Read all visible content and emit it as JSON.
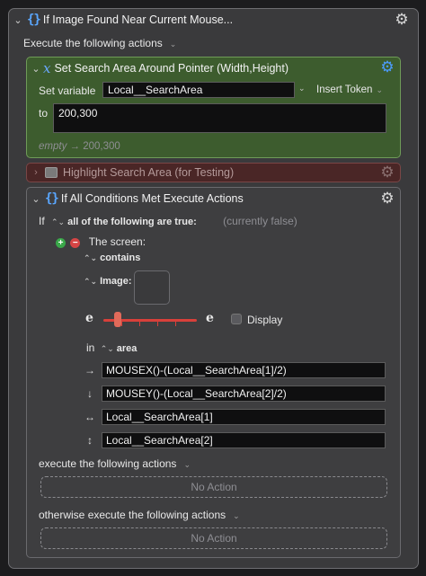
{
  "outer": {
    "title": "If Image Found Near Current Mouse...",
    "execute_label": "Execute the following actions"
  },
  "set_var": {
    "title": "Set Search Area Around Pointer (Width,Height)",
    "set_variable_label": "Set variable",
    "variable_name": "Local__SearchArea",
    "insert_token_label": "Insert Token",
    "to_label": "to",
    "value": "200,300",
    "preview_empty": "empty",
    "preview_value": "200,300"
  },
  "highlight": {
    "title": "Highlight Search Area (for Testing)"
  },
  "inner_if": {
    "title": "If All Conditions Met Execute Actions",
    "if_label": "If",
    "scope": "all of the following are true:",
    "status": "(currently false)",
    "condition_label": "The screen:",
    "contains_label": "contains",
    "image_label": "Image:",
    "display_label": "Display",
    "fuzz_value": 0.13,
    "in_label": "in",
    "area_label": "area",
    "area_fields": [
      {
        "arrow": "→",
        "value": "MOUSEX()-(Local__SearchArea[1]/2)"
      },
      {
        "arrow": "↓",
        "value": "MOUSEY()-(Local__SearchArea[2]/2)"
      },
      {
        "arrow": "↔",
        "value": "Local__SearchArea[1]"
      },
      {
        "arrow": "↕",
        "value": "Local__SearchArea[2]"
      }
    ],
    "execute_label": "execute the following actions",
    "otherwise_label": "otherwise execute the following actions",
    "no_action_1": "No Action",
    "no_action_2": "No Action"
  },
  "colors": {
    "accent": "#4c9cff",
    "enabled_action": "#3d5c2e",
    "disabled_action": "#4a2626",
    "slider": "#d8403a"
  },
  "icons": {
    "gear": "gear-icon",
    "braces": "braces-icon",
    "variable": "variable-x-icon"
  }
}
